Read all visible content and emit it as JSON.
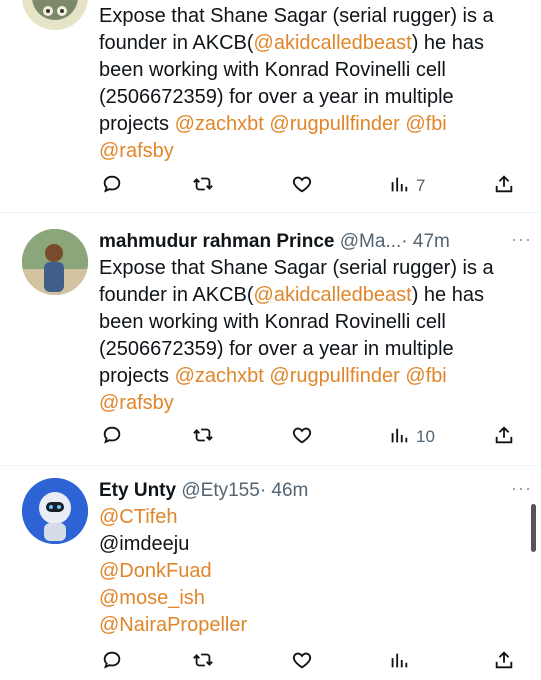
{
  "tweets": [
    {
      "name": "",
      "handle": "",
      "time": "",
      "body_prefix": "Expose that Shane Sagar (serial rugger) is a\nfounder in AKCB(",
      "body_mention": "@akidcalledbeast",
      "body_mid": ") he has\nbeen working with Konrad Rovinelli cell\n(2506672359) for over a year in multiple\nprojects ",
      "trailing_mentions": [
        "@zachxbt",
        "@rugpullfinder",
        "@fbi",
        "@rafsby"
      ],
      "views": "7"
    },
    {
      "name": "mahmudur rahman Prince",
      "handle": "@Ma...",
      "time": "· 47m",
      "body_prefix": "Expose that Shane Sagar (serial rugger) is a\nfounder in AKCB(",
      "body_mention": "@akidcalledbeast",
      "body_mid": ") he has\nbeen working with Konrad Rovinelli cell\n(2506672359) for over a year in multiple\nprojects ",
      "trailing_mentions": [
        "@zachxbt",
        "@rugpullfinder",
        "@fbi",
        "@rafsby"
      ],
      "views": "10"
    },
    {
      "name": "Ety Unty",
      "handle": "@Ety155",
      "time": "· 46m",
      "lines": [
        {
          "text": "@CTifeh",
          "mention": true
        },
        {
          "text": "@imdeeju",
          "mention": false
        },
        {
          "text": "@DonkFuad",
          "mention": true
        },
        {
          "text": "@mose_ish",
          "mention": true
        },
        {
          "text": "@NairaPropeller",
          "mention": true
        }
      ],
      "views": ""
    }
  ],
  "more_label": "···",
  "icons": [
    "reply-icon",
    "retweet-icon",
    "like-icon",
    "views-icon",
    "share-icon"
  ],
  "colors": {
    "mention": "#e0862a",
    "meta": "#536471"
  }
}
